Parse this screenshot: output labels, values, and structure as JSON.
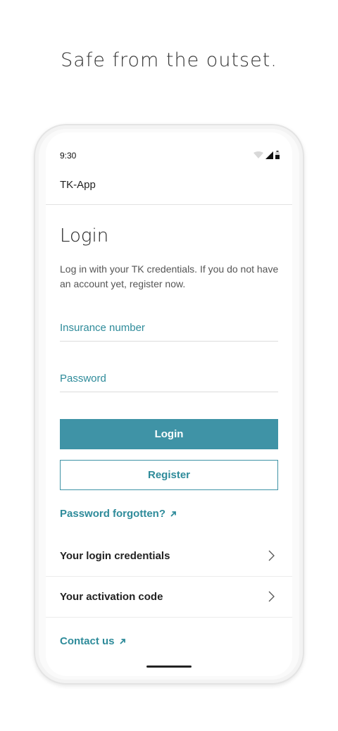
{
  "headline": "Safe from the outset.",
  "status": {
    "time": "9:30"
  },
  "app": {
    "title": "TK-App"
  },
  "login": {
    "title": "Login",
    "intro": "Log in with your TK credentials. If you do not have an account yet, register now.",
    "insurance_placeholder": "Insurance number",
    "password_placeholder": "Password",
    "login_label": "Login",
    "register_label": "Register",
    "forgot_label": "Password forgotten?",
    "rows": [
      {
        "label": "Your login credentials"
      },
      {
        "label": "Your activation code"
      }
    ],
    "contact_label": "Contact us"
  },
  "colors": {
    "accent": "#3f93a6",
    "link": "#2e8b9a"
  }
}
